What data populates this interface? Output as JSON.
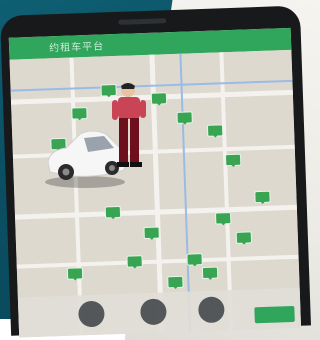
{
  "scene": {
    "description_colors": {
      "background": "#0b4f64",
      "table": "#f1f0ec",
      "phone_body": "#17191b",
      "map_marker": "#39a553",
      "app_bar": "#2fa65b",
      "car": "#f5f5f5",
      "figure_shirt": "#8f1d2a",
      "figure_pants": "#6d0f1d"
    }
  },
  "app": {
    "title": "约租车平台"
  },
  "icons": {
    "home": "home-icon",
    "search": "search-icon",
    "target": "target-icon"
  }
}
